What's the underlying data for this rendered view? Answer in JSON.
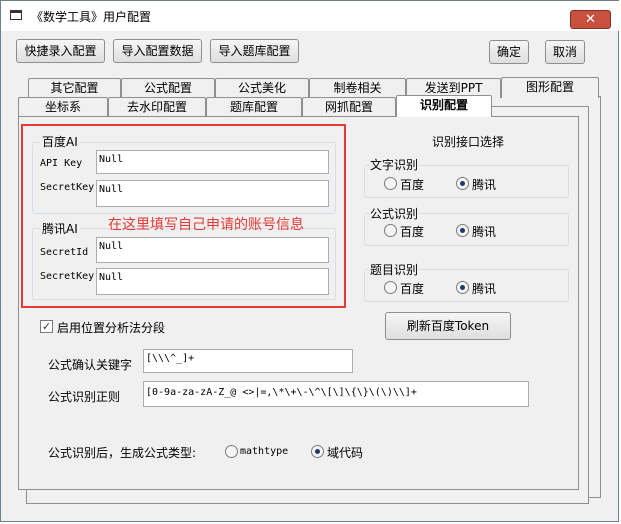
{
  "window": {
    "title": "《数学工具》用户配置",
    "close_glyph": "✕"
  },
  "toolbar": {
    "quick_import": "快捷录入配置",
    "import_config": "导入配置数据",
    "import_bank": "导入题库配置",
    "ok": "确定",
    "cancel": "取消"
  },
  "tabs_back": [
    "其它配置",
    "公式配置",
    "公式美化",
    "制卷相关",
    "发送到PPT",
    "图形配置"
  ],
  "tabs_front": [
    "坐标系",
    "去水印配置",
    "题库配置",
    "网抓配置",
    "识别配置"
  ],
  "baidu": {
    "title": "百度AI",
    "api_key_label": "API Key",
    "api_key_value": "Null",
    "secret_label": "SecretKey",
    "secret_value": "Null"
  },
  "tencent": {
    "title": "腾讯AI",
    "id_label": "SecretId",
    "id_value": "Null",
    "key_label": "SecretKey",
    "key_value": "Null"
  },
  "annotation": "在这里填写自己申请的账号信息",
  "recog": {
    "title": "识别接口选择",
    "text_group": "文字识别",
    "formula_group": "公式识别",
    "question_group": "题目识别",
    "opt_baidu": "百度",
    "opt_tencent": "腾讯",
    "refresh_btn": "刷新百度Token"
  },
  "segment_checkbox": "启用位置分析法分段",
  "keyword": {
    "label": "公式确认关键字",
    "value": "[\\\\\\^_]+"
  },
  "regex": {
    "label": "公式识别正则",
    "value": "[0-9a-za-zA-Z_@ <>|=,\\*\\+\\-\\^\\[\\]\\{\\}\\(\\)\\\\]+"
  },
  "formula_type": {
    "label": "公式识别后，生成公式类型:",
    "opt1": "mathtype",
    "opt2": "域代码"
  }
}
